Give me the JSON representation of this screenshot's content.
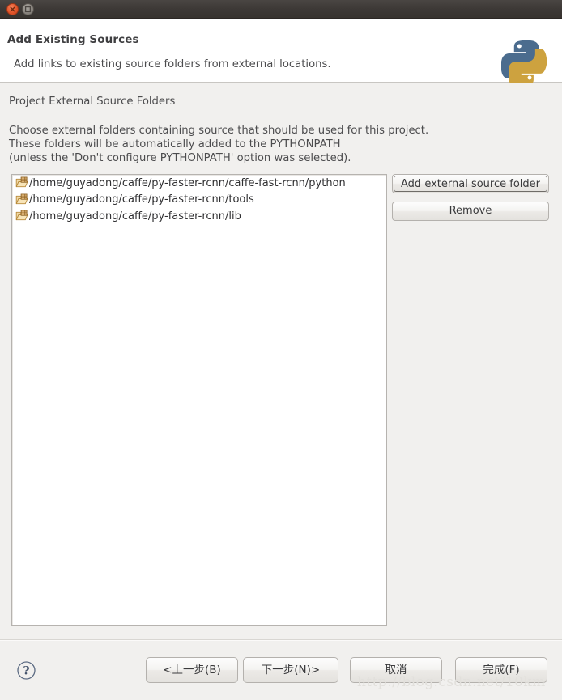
{
  "titlebar": {
    "close_icon": "close-icon",
    "maximize_icon": "maximize-icon"
  },
  "header": {
    "title": "Add Existing Sources",
    "subtitle": "Add links to existing source folders from external locations.",
    "logo_icon": "python-logo-icon",
    "logo_blue": "#4b6c8e",
    "logo_yellow": "#cda23f"
  },
  "main": {
    "section_title": "Project External Source Folders",
    "description": "Choose external folders containing source that should be used for this project.\nThese folders will be automatically added to the PYTHONPATH\n(unless the 'Don't configure PYTHONPATH' option was selected).",
    "folders": [
      {
        "icon": "folder-icon",
        "path": "/home/guyadong/caffe/py-faster-rcnn/caffe-fast-rcnn/python"
      },
      {
        "icon": "folder-icon",
        "path": "/home/guyadong/caffe/py-faster-rcnn/tools"
      },
      {
        "icon": "folder-icon",
        "path": "/home/guyadong/caffe/py-faster-rcnn/lib"
      }
    ],
    "buttons": {
      "add": "Add external source folder",
      "remove": "Remove"
    }
  },
  "footer": {
    "help_icon": "help-question-icon",
    "back": "<上一步(B)",
    "next": "下一步(N)>",
    "cancel": "取消",
    "finish": "完成(F)",
    "watermark": "http://blog.csdn.net/10km"
  }
}
